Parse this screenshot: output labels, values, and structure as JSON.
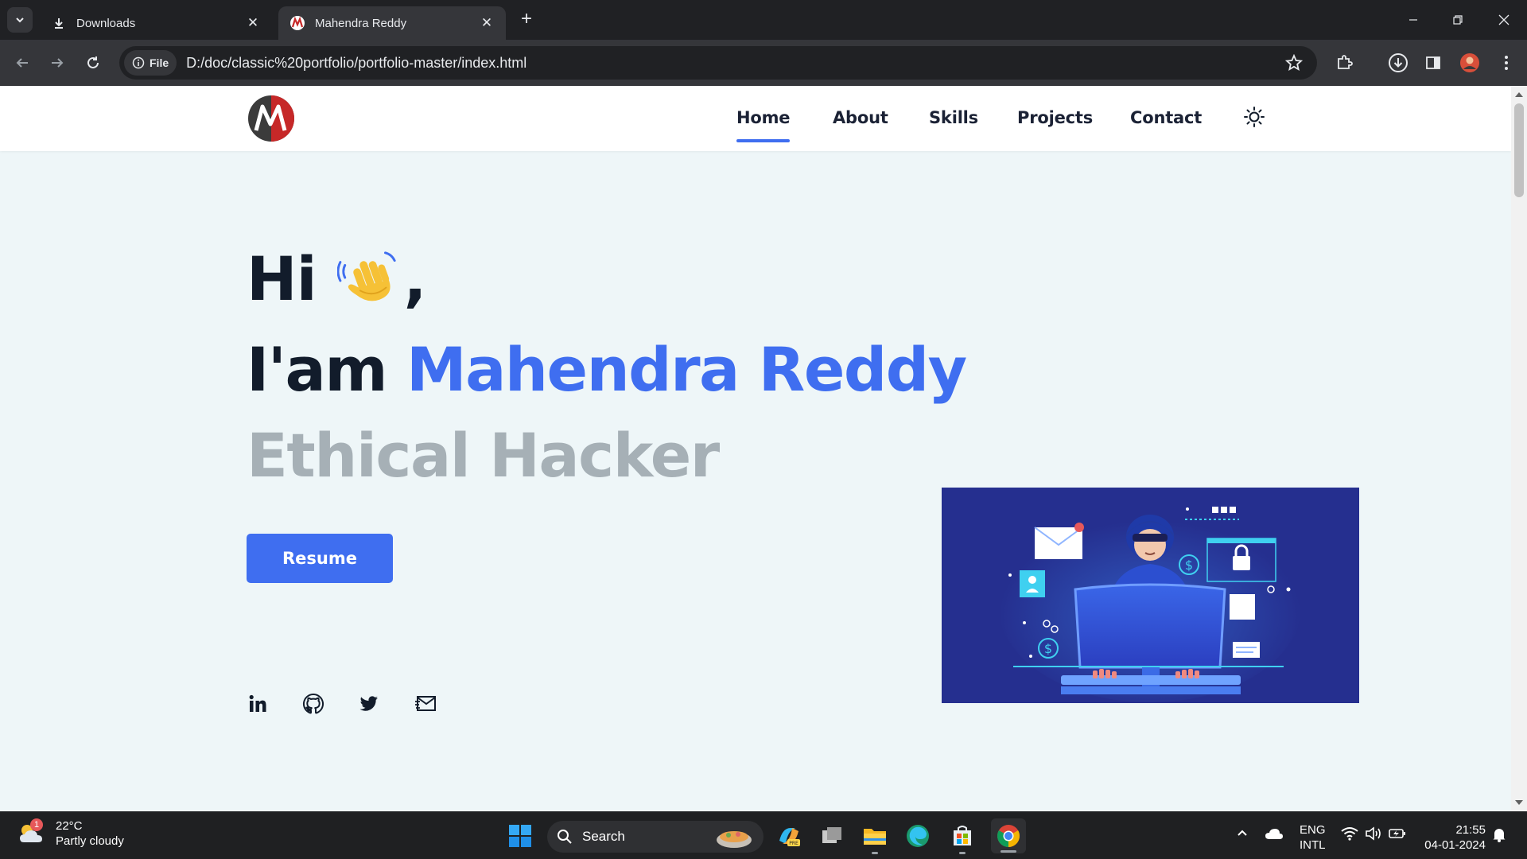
{
  "browser": {
    "tabs": [
      {
        "title": "Downloads",
        "icon": "download-icon",
        "active": false
      },
      {
        "title": "Mahendra Reddy",
        "icon": "site-logo-icon",
        "active": true
      }
    ],
    "site_chip": "File",
    "url": "D:/doc/classic%20portfolio/portfolio-master/index.html"
  },
  "nav": {
    "items": [
      {
        "label": "Home",
        "active": true
      },
      {
        "label": "About"
      },
      {
        "label": "Skills"
      },
      {
        "label": "Projects"
      },
      {
        "label": "Contact"
      }
    ]
  },
  "hero": {
    "greeting": "Hi",
    "comma": ",",
    "intro": "I'am",
    "name": "Mahendra Reddy",
    "role": "Ethical Hacker",
    "resume_label": "Resume",
    "social": [
      "linkedin-icon",
      "github-icon",
      "twitter-icon",
      "mail-icon"
    ]
  },
  "taskbar": {
    "weather_temp": "22°C",
    "weather_desc": "Partly cloudy",
    "weather_badge": "1",
    "search_label": "Search",
    "lang_top": "ENG",
    "lang_bottom": "INTL",
    "time": "21:55",
    "date": "04-01-2024"
  },
  "colors": {
    "accent": "#3f6ef0",
    "heading": "#121c2b",
    "muted": "#a6b0b6",
    "page_bg": "#eef6f8",
    "illustration_bg": "#252f8f"
  }
}
